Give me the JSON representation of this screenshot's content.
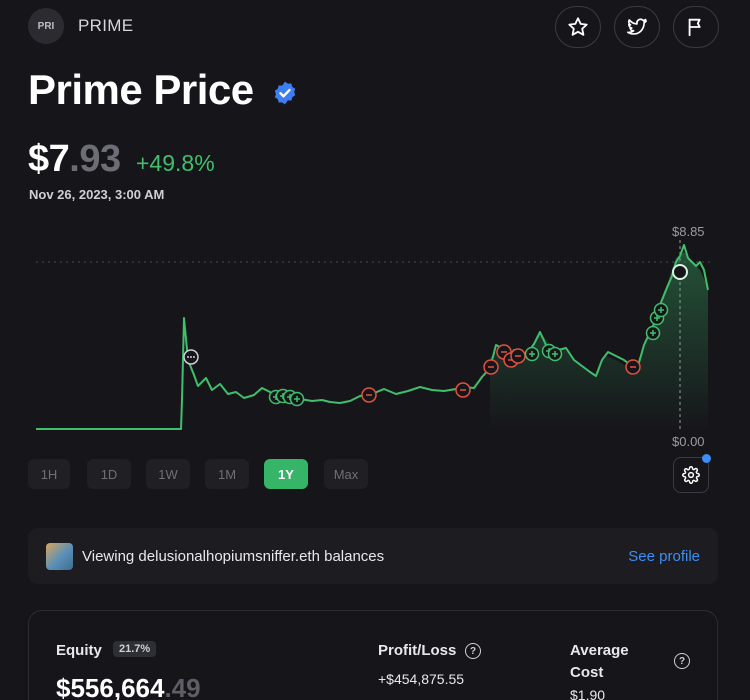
{
  "header": {
    "token_badge": "PRI",
    "token_name": "PRIME",
    "actions": [
      "star-icon",
      "twitter-icon",
      "flag-icon"
    ]
  },
  "title": "Prime Price",
  "price": {
    "main": "$7",
    "decimals": ".93",
    "change": "+49.8%",
    "date": "Nov 26, 2023, 3:00 AM"
  },
  "chart": {
    "max_label": "$8.85",
    "min_label": "$0.00",
    "line_color": "#3fbf6c",
    "sell_color": "#e0523f",
    "buy_color": "#3fbf6c"
  },
  "ranges": {
    "items": [
      "1H",
      "1D",
      "1W",
      "1M",
      "1Y",
      "Max"
    ],
    "active": "1Y"
  },
  "viewing": {
    "text": "Viewing delusionalhopiumsniffer.eth balances",
    "link": "See profile"
  },
  "stats": {
    "equity_label": "Equity",
    "equity_pct": "21.7%",
    "equity_main": "$556,664",
    "equity_decimals": ".49",
    "pl_label": "Profit/Loss",
    "pl_value": "+$454,875.55",
    "avg_label_1": "Average",
    "avg_label_2": "Cost",
    "avg_value": "$1.90"
  }
}
